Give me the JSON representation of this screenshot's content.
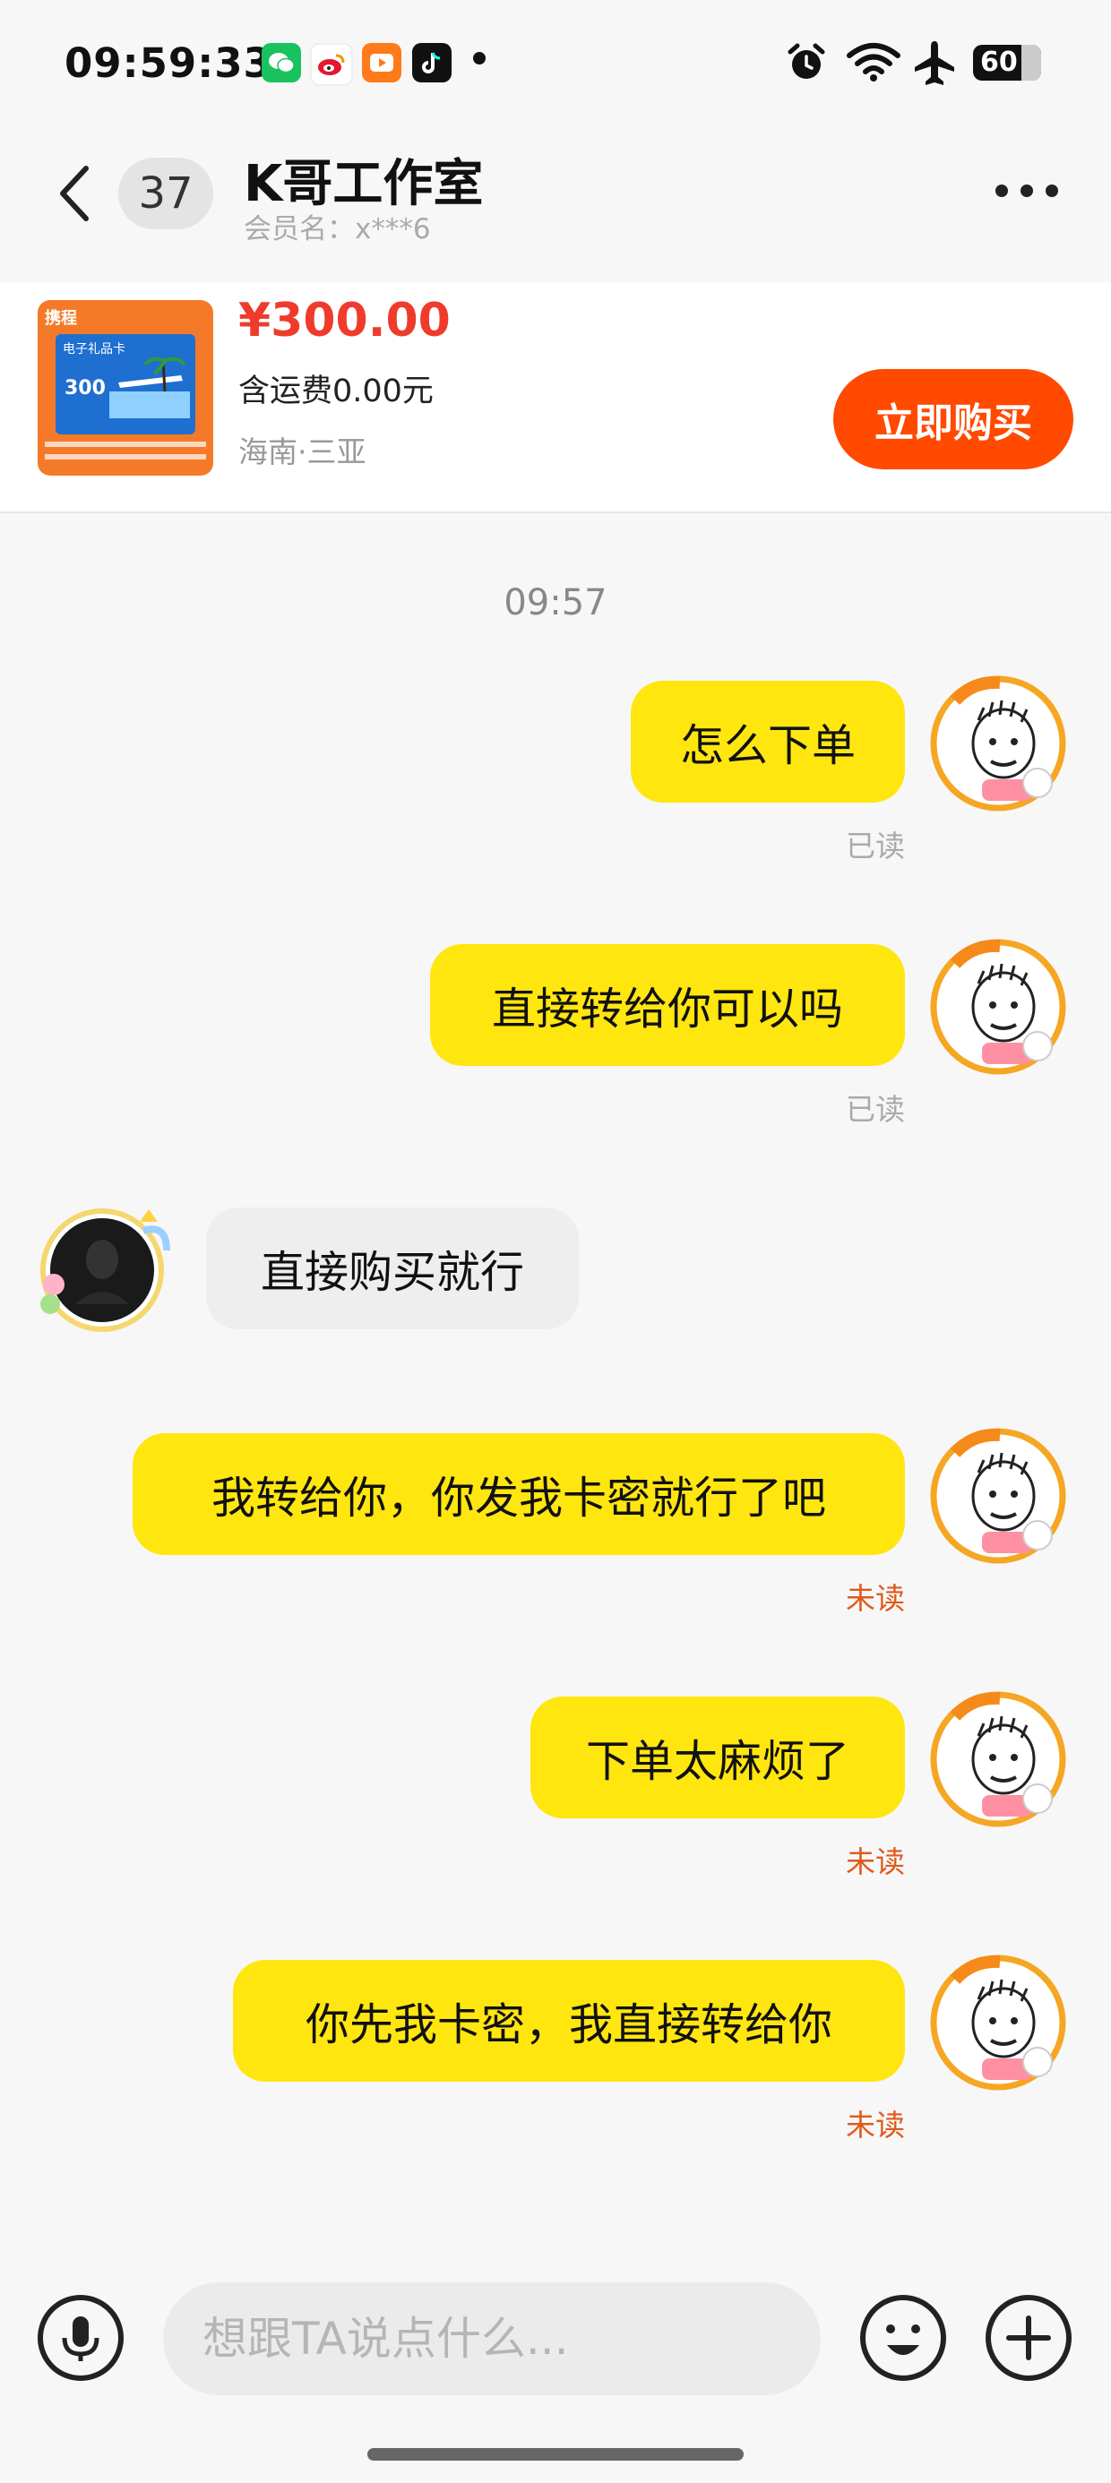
{
  "status_bar": {
    "time": "09:59:33",
    "apps": [
      "wechat-icon",
      "weibo-icon",
      "video-app-icon",
      "tiktok-icon"
    ],
    "battery": "60"
  },
  "header": {
    "unread_count": "37",
    "title": "K哥工作室",
    "member": "会员名：x***6"
  },
  "product": {
    "price": "¥300.00",
    "shipping": "含运费0.00元",
    "location": "海南·三亚",
    "buy_label": "立即购买",
    "thumb_brand": "携程",
    "thumb_subtitle": "电子礼品卡",
    "thumb_value": "300"
  },
  "chat": {
    "timestamp": "09:57",
    "messages": [
      {
        "side": "mine",
        "text": "怎么下单",
        "status": "已读"
      },
      {
        "side": "mine",
        "text": "直接转给你可以吗",
        "status": "已读"
      },
      {
        "side": "theirs",
        "text": "直接购买就行"
      },
      {
        "side": "mine",
        "text": "我转给你，你发我卡密就行了吧",
        "status": "未读"
      },
      {
        "side": "mine",
        "text": "下单太麻烦了",
        "status": "未读"
      },
      {
        "side": "mine",
        "text": "你先我卡密，我直接转给你",
        "status": "未读"
      }
    ]
  },
  "composer": {
    "placeholder": "想跟TA说点什么..."
  },
  "colors": {
    "accent": "#ff4a00",
    "price": "#ef3b2c",
    "my_bubble": "#ffe60f",
    "their_bubble": "#eeeeee",
    "unread": "#e05a1a"
  }
}
